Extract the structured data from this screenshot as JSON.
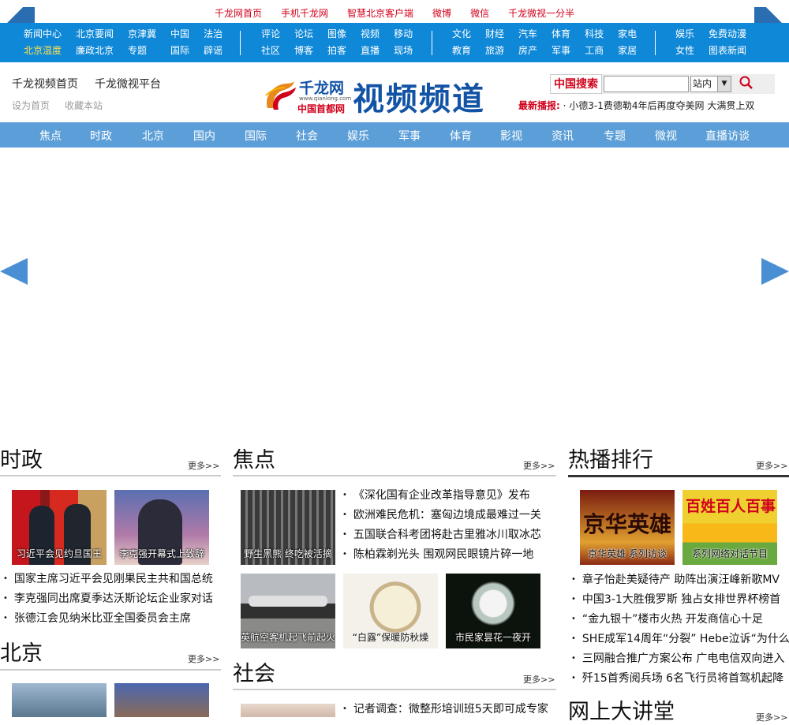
{
  "toplinks": [
    "千龙网首页",
    "手机千龙网",
    "智慧北京客户端",
    "微博",
    "微信",
    "千龙微视一分半"
  ],
  "nav": {
    "g1": [
      "新闻中心",
      "北京温度",
      "北京要闻",
      "廉政北京",
      "京津冀",
      "专题",
      "中国",
      "国际",
      "法治",
      "辟谣"
    ],
    "g2": [
      "评论",
      "社区",
      "论坛",
      "博客",
      "图像",
      "拍客",
      "视频",
      "直播",
      "移动",
      "现场"
    ],
    "g3": [
      "文化",
      "教育",
      "财经",
      "旅游",
      "汽车",
      "房产",
      "体育",
      "军事",
      "科技",
      "工商",
      "家电",
      "家居"
    ],
    "g4": [
      "娱乐",
      "女性",
      "免费动漫",
      "图表新闻"
    ]
  },
  "header": {
    "link1": "千龙视频首页",
    "link2": "千龙微视平台",
    "small1": "设为首页",
    "small2": "收藏本站",
    "logo_site": "千龙网",
    "logo_url": "www.qianlong.com",
    "logo_slogan": "中国首都网",
    "logo_channel": "视频频道",
    "search_label": "中国搜索",
    "search_scope": "站内",
    "search_arrow": "▼",
    "search_icon": "search-icon",
    "broadcast_label": "最新播报:",
    "broadcast_text": "· 小德3-1费德勒4年后再度夺美网 大满贯上双"
  },
  "mainnav": [
    "焦点",
    "时政",
    "北京",
    "国内",
    "国际",
    "社会",
    "娱乐",
    "军事",
    "体育",
    "影视",
    "资讯",
    "专题",
    "微视",
    "直播访谈"
  ],
  "shizheng": {
    "title": "时政",
    "more": "更多>>",
    "thumbs": [
      "习近平会见约旦国王",
      "李克强开幕式上致辞"
    ],
    "items": [
      "国家主席习近平会见刚果民主共和国总统",
      "李克强同出席夏季达沃斯论坛企业家对话",
      "张德江会见纳米比亚全国委员会主席"
    ]
  },
  "jiaodian": {
    "title": "焦点",
    "more": "更多>>",
    "thumbs": [
      "野生黑熊 终吃被活摘",
      "英航空客机起飞前起火",
      "“白露”保暖防秋燥",
      "市民家昙花一夜开"
    ],
    "items": [
      "《深化国有企业改革指导意见》发布",
      "欧洲难民危机：塞匈边境成最难过一关",
      "五国联合科考团将赴古里雅冰川取冰芯",
      "陈柏霖剃光头 围观网民眼镜片碎一地"
    ]
  },
  "rebo": {
    "title": "热播排行",
    "more": "更多>>",
    "thumbs": [
      "京华英雄 系列访谈",
      "系列网络对话节目"
    ],
    "thumb_art": [
      "京华英雄",
      "百姓百人百事"
    ],
    "items": [
      "章子怡赴美疑待产 助阵出演汪峰新歌MV",
      "中国3-1大胜俄罗斯 独占女排世界杯榜首",
      "“金九银十”楼市火热 开发商信心十足",
      "SHE成军14周年“分裂” Hebe泣诉“为什么”",
      "三网融合推广方案公布 广电电信双向进入",
      "歼15首秀阅兵场 6名飞行员将首驾机起降"
    ]
  },
  "beijing": {
    "title": "北京",
    "more": "更多>>"
  },
  "shehui": {
    "title": "社会",
    "more": "更多>>",
    "items": [
      "记者调查：微整形培训班5天即可成专家"
    ]
  },
  "jiangtang": {
    "title": "网上大讲堂",
    "more": "更多>>"
  }
}
